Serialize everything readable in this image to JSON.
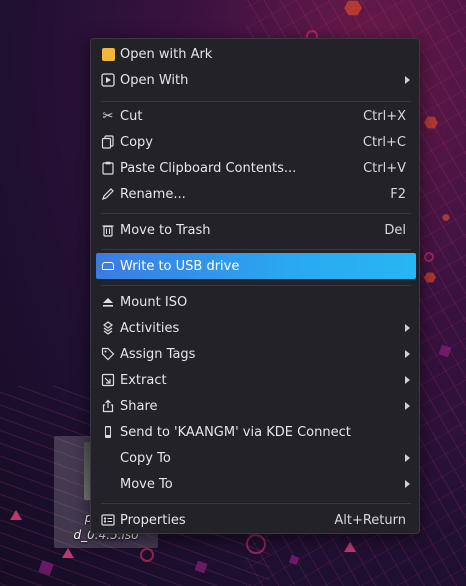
{
  "menu": {
    "items": [
      {
        "label": "Open with Ark",
        "icon": "ark-icon",
        "shortcut": "",
        "submenu": false
      },
      {
        "label": "Open With",
        "icon": "open-with-icon",
        "shortcut": "",
        "submenu": true
      },
      {
        "label": "Cut",
        "icon": "scissors-icon",
        "shortcut": "Ctrl+X",
        "submenu": false
      },
      {
        "label": "Copy",
        "icon": "copy-icon",
        "shortcut": "Ctrl+C",
        "submenu": false
      },
      {
        "label": "Paste Clipboard Contents...",
        "icon": "paste-icon",
        "shortcut": "Ctrl+V",
        "submenu": false
      },
      {
        "label": "Rename...",
        "icon": "pencil-icon",
        "shortcut": "F2",
        "submenu": false
      },
      {
        "label": "Move to Trash",
        "icon": "trash-icon",
        "shortcut": "Del",
        "submenu": false
      },
      {
        "label": "Write to USB drive",
        "icon": "usb-drive-icon",
        "shortcut": "",
        "submenu": false,
        "highlighted": true
      },
      {
        "label": "Mount ISO",
        "icon": "eject-icon",
        "shortcut": "",
        "submenu": false
      },
      {
        "label": "Activities",
        "icon": "activities-icon",
        "shortcut": "",
        "submenu": true
      },
      {
        "label": "Assign Tags",
        "icon": "tag-icon",
        "shortcut": "",
        "submenu": true
      },
      {
        "label": "Extract",
        "icon": "extract-icon",
        "shortcut": "",
        "submenu": true
      },
      {
        "label": "Share",
        "icon": "share-icon",
        "shortcut": "",
        "submenu": true
      },
      {
        "label": "Send to 'KAANGM' via KDE Connect",
        "icon": "phone-icon",
        "shortcut": "",
        "submenu": false
      },
      {
        "label": "Copy To",
        "icon": "",
        "shortcut": "",
        "submenu": true
      },
      {
        "label": "Move To",
        "icon": "",
        "shortcut": "",
        "submenu": true
      },
      {
        "label": "Properties",
        "icon": "properties-icon",
        "shortcut": "Alt+Return",
        "submenu": false
      }
    ]
  },
  "desktop": {
    "file_name_line1": "primed",
    "file_name_line2": "d_0.4.5.iso"
  },
  "colors": {
    "highlight": "#3daee9",
    "menu_bg": "#232228",
    "ark_icon": "#f4b53c"
  }
}
